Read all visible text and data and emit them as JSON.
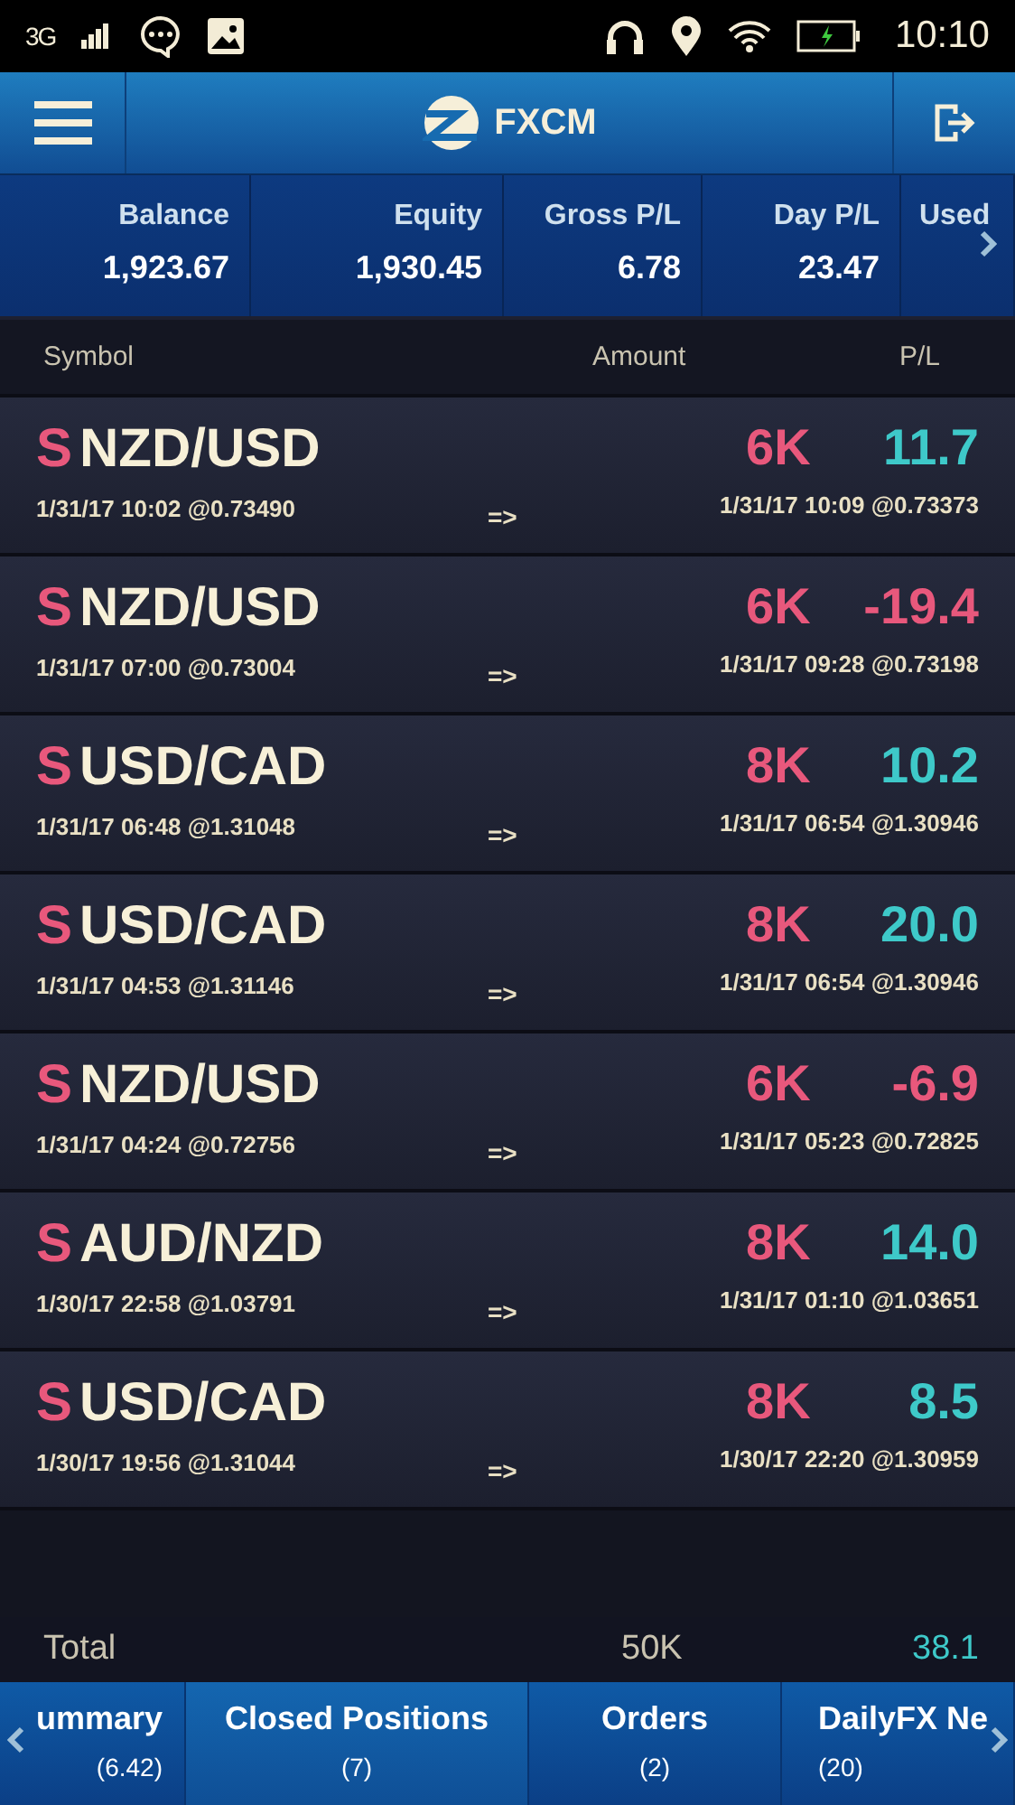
{
  "status_bar": {
    "network": "3G",
    "time": "10:10"
  },
  "header": {
    "title": "FXCM"
  },
  "summary": [
    {
      "label": "Balance",
      "value": "1,923.67"
    },
    {
      "label": "Equity",
      "value": "1,930.45"
    },
    {
      "label": "Gross P/L",
      "value": "6.78"
    },
    {
      "label": "Day P/L",
      "value": "23.47"
    },
    {
      "label": "Used"
    }
  ],
  "columns": [
    "Symbol",
    "Amount",
    "P/L"
  ],
  "rows": [
    {
      "side": "S",
      "symbol": "NZD/USD",
      "open": "1/31/17 10:02 @0.73490",
      "arrow": "=>",
      "amount": "6K",
      "close": "1/31/17 10:09 @0.73373",
      "pl": "11.7",
      "color": "#3ec9c9"
    },
    {
      "side": "S",
      "symbol": "NZD/USD",
      "open": "1/31/17 07:00 @0.73004",
      "arrow": "=>",
      "amount": "6K",
      "close": "1/31/17 09:28 @0.73198",
      "pl": "-19.4",
      "color": "#e8587c"
    },
    {
      "side": "S",
      "symbol": "USD/CAD",
      "open": "1/31/17 06:48 @1.31048",
      "arrow": "=>",
      "amount": "8K",
      "close": "1/31/17 06:54 @1.30946",
      "pl": "10.2",
      "color": "#3ec9c9"
    },
    {
      "side": "S",
      "symbol": "USD/CAD",
      "open": "1/31/17 04:53 @1.31146",
      "arrow": "=>",
      "amount": "8K",
      "close": "1/31/17 06:54 @1.30946",
      "pl": "20.0",
      "color": "#3ec9c9"
    },
    {
      "side": "S",
      "symbol": "NZD/USD",
      "open": "1/31/17 04:24 @0.72756",
      "arrow": "=>",
      "amount": "6K",
      "close": "1/31/17 05:23 @0.72825",
      "pl": "-6.9",
      "color": "#e8587c"
    },
    {
      "side": "S",
      "symbol": "AUD/NZD",
      "open": "1/30/17 22:58 @1.03791",
      "arrow": "=>",
      "amount": "8K",
      "close": "1/31/17 01:10 @1.03651",
      "pl": "14.0",
      "color": "#3ec9c9"
    },
    {
      "side": "S",
      "symbol": "USD/CAD",
      "open": "1/30/17 19:56 @1.31044",
      "arrow": "=>",
      "amount": "8K",
      "close": "1/30/17 22:20 @1.30959",
      "pl": "8.5",
      "color": "#3ec9c9"
    }
  ],
  "total": {
    "label": "Total",
    "amount": "50K",
    "pl": "38.1"
  },
  "tabs": [
    {
      "label": "ummary",
      "count": "(6.42)",
      "selected": false
    },
    {
      "label": "Closed Positions",
      "count": "(7)",
      "selected": true
    },
    {
      "label": "Orders",
      "count": "(2)",
      "selected": false
    },
    {
      "label": "DailyFX Ne",
      "count": "(20)",
      "selected": false
    }
  ]
}
